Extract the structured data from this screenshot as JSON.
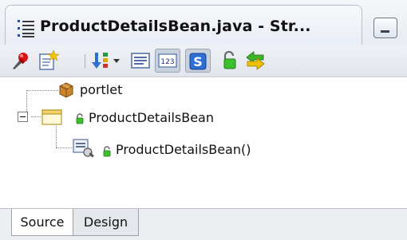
{
  "window": {
    "title": "ProductDetailsBean.java - Str..."
  },
  "toolbar": {
    "buttons": [
      {
        "icon": "pin-icon"
      },
      {
        "icon": "new-element-icon"
      },
      {
        "icon": "sort-dropdown-icon"
      },
      {
        "icon": "show-fields-icon"
      },
      {
        "icon": "show-123-icon"
      },
      {
        "icon": "show-static-icon"
      },
      {
        "icon": "show-private-icon"
      },
      {
        "icon": "sync-icon"
      }
    ]
  },
  "tree": {
    "items": [
      {
        "label": "portlet",
        "icon": "package-icon"
      },
      {
        "label": "ProductDetailsBean",
        "icon": "class-icon"
      },
      {
        "label": "ProductDetailsBean()",
        "icon": "constructor-icon"
      }
    ]
  },
  "bottom_tabs": [
    {
      "label": "Source",
      "selected": true
    },
    {
      "label": "Design",
      "selected": false
    }
  ]
}
